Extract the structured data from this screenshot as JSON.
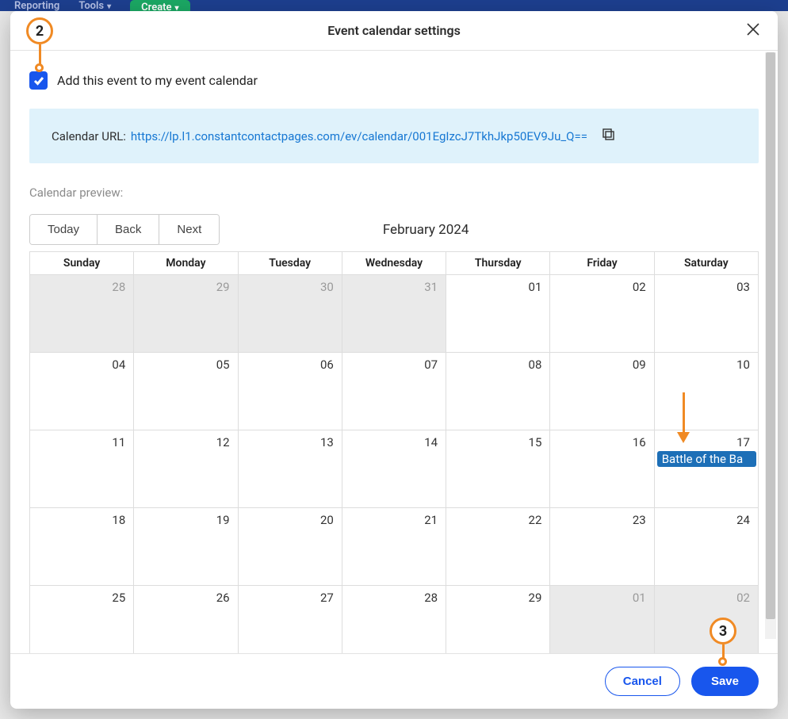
{
  "topbar": {
    "reporting": "Reporting",
    "tools": "Tools",
    "create": "Create"
  },
  "modal": {
    "title": "Event calendar settings",
    "checkbox_label": "Add this event to my event calendar",
    "url_label": "Calendar URL:",
    "url": "https://lp.l1.constantcontactpages.com/ev/calendar/001EgIzcJ7TkhJkp50EV9Ju_Q==",
    "preview_label": "Calendar preview:",
    "nav": {
      "today": "Today",
      "back": "Back",
      "next": "Next"
    },
    "month": "February 2024",
    "days": [
      "Sunday",
      "Monday",
      "Tuesday",
      "Wednesday",
      "Thursday",
      "Friday",
      "Saturday"
    ],
    "weeks": [
      [
        {
          "n": "28",
          "o": true
        },
        {
          "n": "29",
          "o": true
        },
        {
          "n": "30",
          "o": true
        },
        {
          "n": "31",
          "o": true
        },
        {
          "n": "01"
        },
        {
          "n": "02"
        },
        {
          "n": "03"
        }
      ],
      [
        {
          "n": "04"
        },
        {
          "n": "05"
        },
        {
          "n": "06"
        },
        {
          "n": "07"
        },
        {
          "n": "08"
        },
        {
          "n": "09"
        },
        {
          "n": "10"
        }
      ],
      [
        {
          "n": "11"
        },
        {
          "n": "12"
        },
        {
          "n": "13"
        },
        {
          "n": "14"
        },
        {
          "n": "15"
        },
        {
          "n": "16"
        },
        {
          "n": "17",
          "event": "Battle of the Ba"
        }
      ],
      [
        {
          "n": "18"
        },
        {
          "n": "19"
        },
        {
          "n": "20"
        },
        {
          "n": "21"
        },
        {
          "n": "22"
        },
        {
          "n": "23"
        },
        {
          "n": "24"
        }
      ],
      [
        {
          "n": "25"
        },
        {
          "n": "26"
        },
        {
          "n": "27"
        },
        {
          "n": "28"
        },
        {
          "n": "29"
        },
        {
          "n": "01",
          "o": true
        },
        {
          "n": "02",
          "o": true
        }
      ]
    ],
    "cancel": "Cancel",
    "save": "Save"
  },
  "callouts": {
    "c2": "2",
    "c3": "3"
  }
}
